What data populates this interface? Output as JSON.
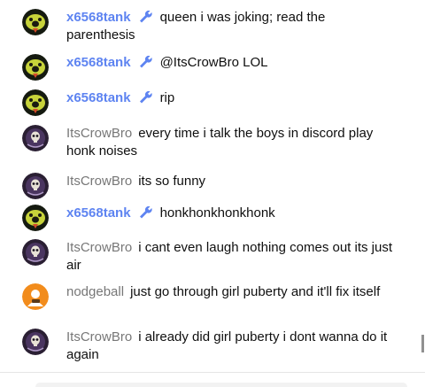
{
  "colors": {
    "moderator_name": "#5e84f1",
    "user_name": "#777777",
    "message_text": "#0f0f0f"
  },
  "messages": [
    {
      "author": "x6568tank",
      "moderator": true,
      "avatar": "green-face-avatar",
      "badge": "wrench-icon",
      "text": "queen i was joking; read the parenthesis"
    },
    {
      "author": "x6568tank",
      "moderator": true,
      "avatar": "green-face-avatar",
      "badge": "wrench-icon",
      "text": "@ItsCrowBro LOL"
    },
    {
      "author": "x6568tank",
      "moderator": true,
      "avatar": "green-face-avatar",
      "badge": "wrench-icon",
      "text": "rip"
    },
    {
      "author": "ItsCrowBro",
      "moderator": false,
      "avatar": "purple-skull-avatar",
      "text": "every time i talk the boys in discord play honk noises"
    },
    {
      "author": "ItsCrowBro",
      "moderator": false,
      "avatar": "purple-skull-avatar",
      "text": "its so funny"
    },
    {
      "author": "x6568tank",
      "moderator": true,
      "avatar": "green-face-avatar",
      "badge": "wrench-icon",
      "text": "honkhonkhonkhonk"
    },
    {
      "author": "ItsCrowBro",
      "moderator": false,
      "avatar": "purple-skull-avatar",
      "text": "i cant even laugh nothing comes out its just air"
    },
    {
      "author": "nodgeball",
      "moderator": false,
      "avatar": "orange-default-avatar",
      "text": "just go through girl puberty and it'll fix itself"
    },
    {
      "author": "ItsCrowBro",
      "moderator": false,
      "avatar": "purple-skull-avatar",
      "text": "i already did girl puberty i dont wanna do it again"
    }
  ]
}
